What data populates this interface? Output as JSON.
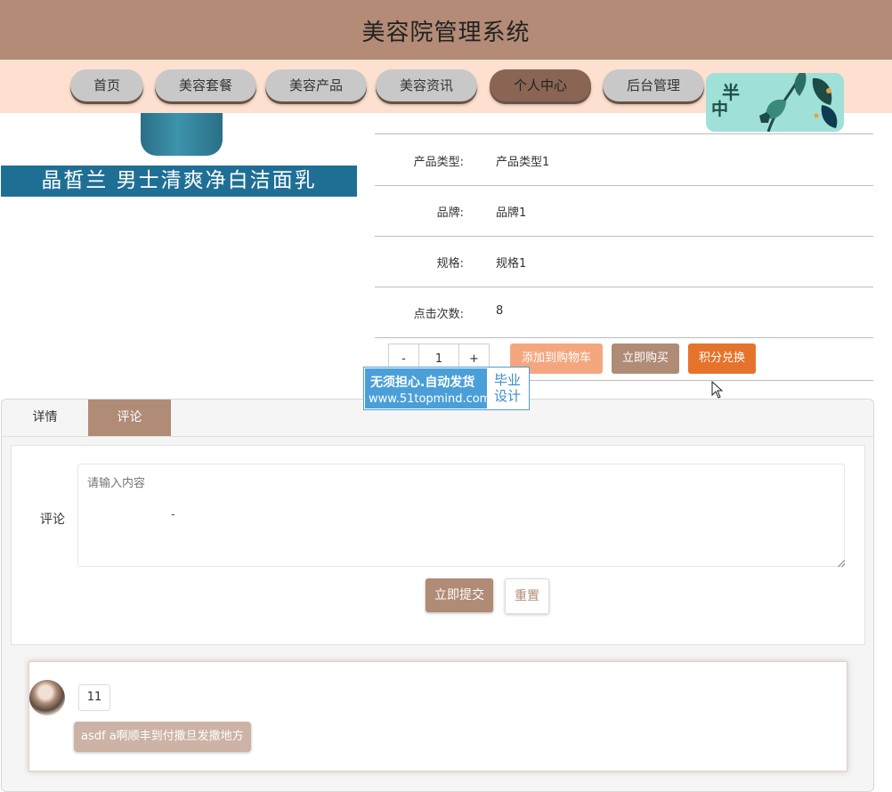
{
  "site": {
    "title": "美容院管理系统"
  },
  "nav": {
    "items": [
      {
        "label": "首页"
      },
      {
        "label": "美容套餐"
      },
      {
        "label": "美容产品"
      },
      {
        "label": "美容资讯"
      },
      {
        "label": "个人中心"
      },
      {
        "label": "后台管理"
      }
    ],
    "active": "个人中心"
  },
  "decoration": {
    "text_top": "半",
    "text_bottom": "中"
  },
  "product": {
    "image_caption": "晶皙兰  男士清爽净白洁面乳",
    "fields": [
      {
        "label": "产品类型:",
        "value": "产品类型1"
      },
      {
        "label": "品牌:",
        "value": "品牌1"
      },
      {
        "label": "规格:",
        "value": "规格1"
      },
      {
        "label": "点击次数:",
        "value": "8"
      }
    ]
  },
  "actions": {
    "qty_minus": "-",
    "qty_value": "1",
    "qty_plus": "+",
    "add_to_cart": "添加到购物车",
    "buy_now": "立即购买",
    "points_exchange": "积分兑换"
  },
  "promo": {
    "line1": "无须担心.自动发货",
    "line2": "www.51topmind.com",
    "right1": "毕业",
    "right2": "设计"
  },
  "tabs": {
    "detail": "详情",
    "comment": "评论"
  },
  "comment_form": {
    "label": "评论",
    "placeholder": "请输入内容",
    "dash": "-",
    "submit": "立即提交",
    "reset": "重置"
  },
  "comments": [
    {
      "user": "11",
      "text": "asdf a啊顺丰到付撒旦发撒地方"
    }
  ],
  "colors": {
    "header": "#b38b76",
    "nav_bar": "#fde0cf",
    "accent": "#b08b76",
    "cart_button": "#f4a77f",
    "exchange_button": "#e6732c"
  }
}
